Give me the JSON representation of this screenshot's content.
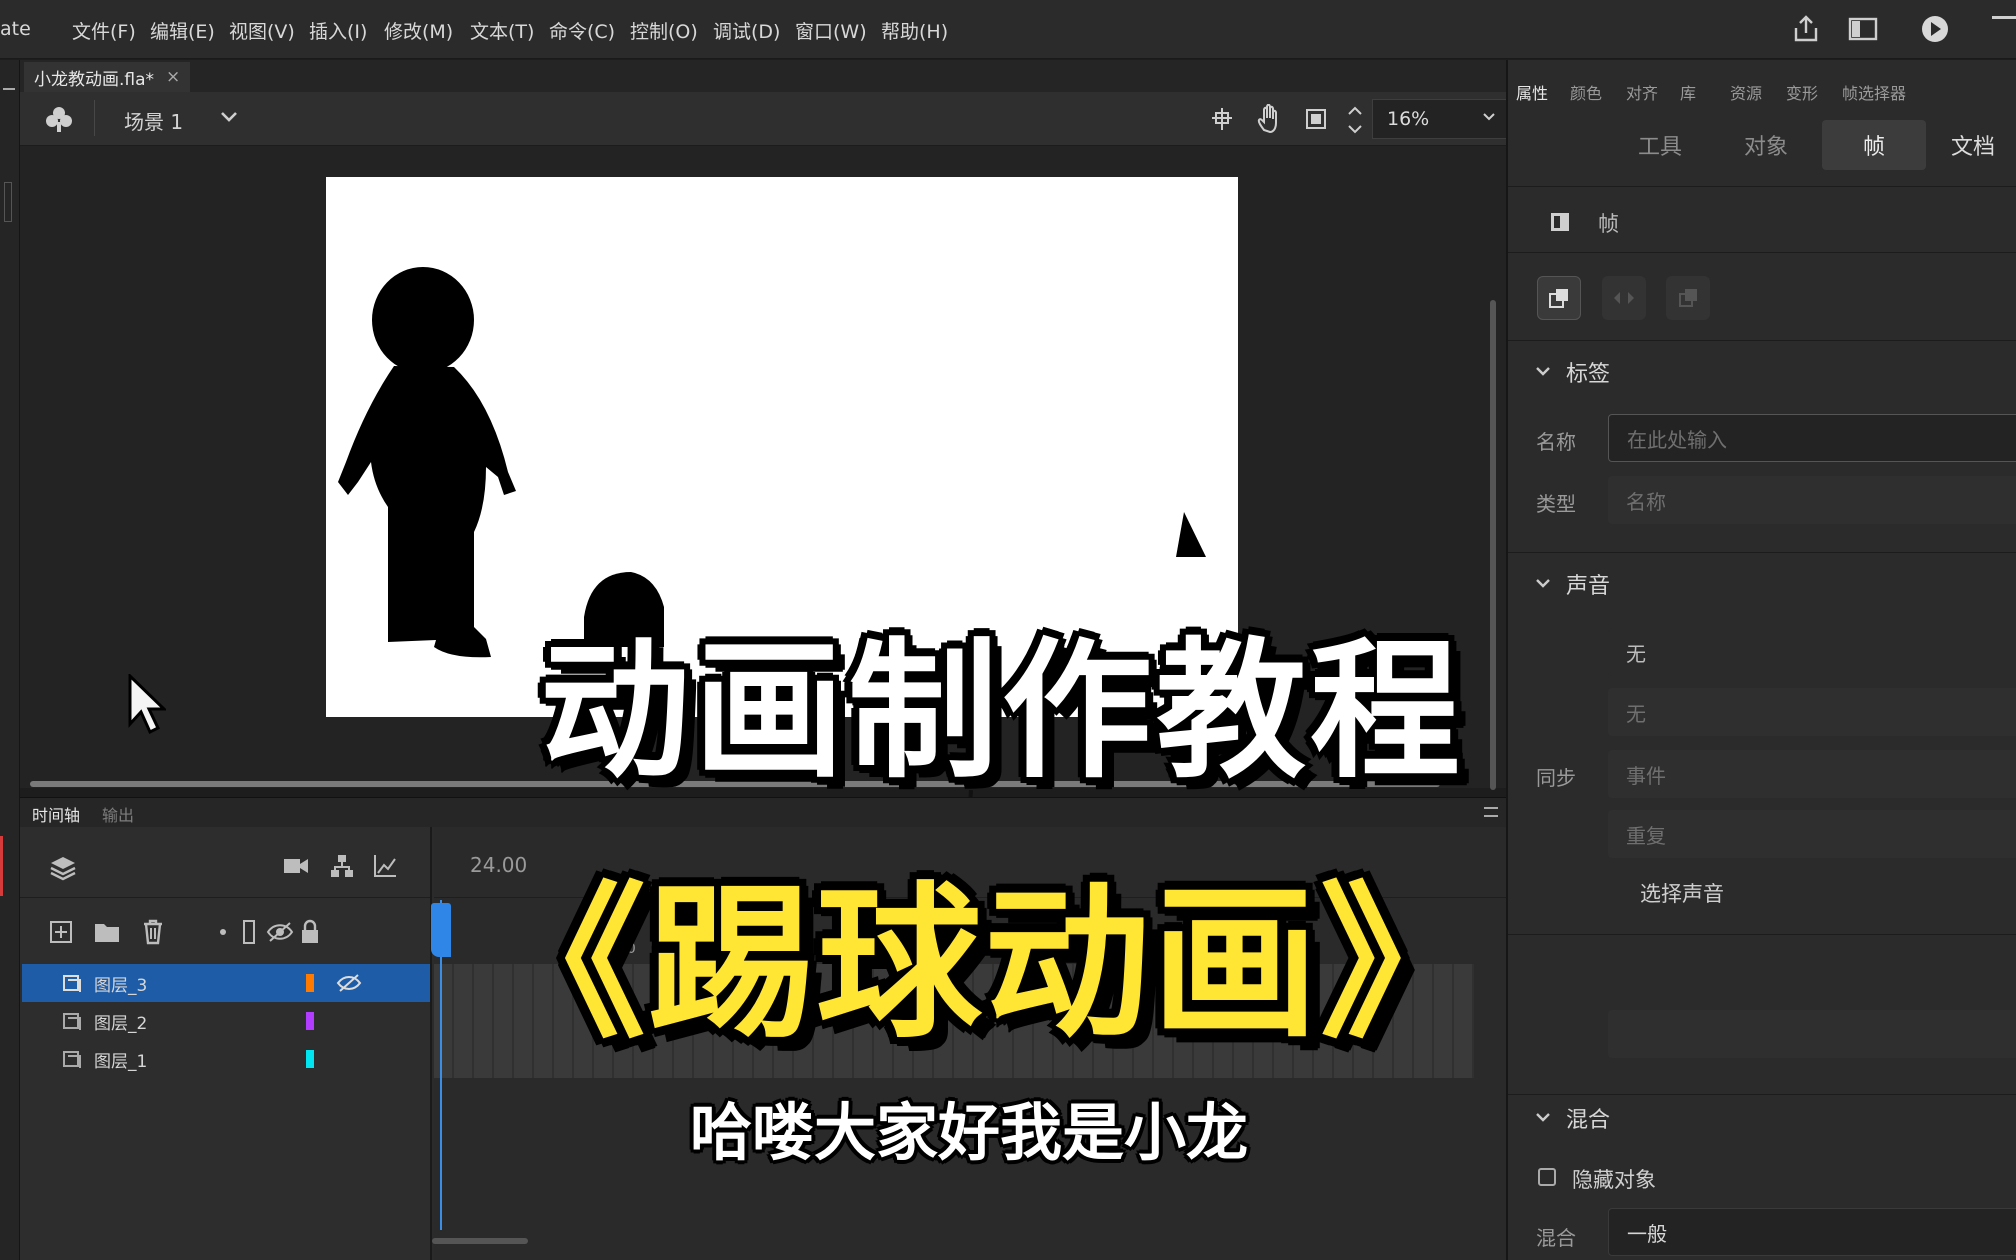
{
  "app": {
    "name_fragment": "ate"
  },
  "menu": [
    "文件(F)",
    "编辑(E)",
    "视图(V)",
    "插入(I)",
    "修改(M)",
    "文本(T)",
    "命令(C)",
    "控制(O)",
    "调试(D)",
    "窗口(W)",
    "帮助(H)"
  ],
  "document": {
    "tab_label": "小龙教动画.fla*",
    "close_glyph": "×"
  },
  "scene": {
    "label": "场景 1",
    "zoom": "16%"
  },
  "timeline": {
    "tabs": [
      "时间轴",
      "输出"
    ],
    "fps": "24.00",
    "frame_marker": "10",
    "layers": [
      {
        "name": "图层_3",
        "color": "#ff7a00",
        "selected": true
      },
      {
        "name": "图层_2",
        "color": "#b23cff",
        "selected": false
      },
      {
        "name": "图层_1",
        "color": "#00e5f0",
        "selected": false
      }
    ]
  },
  "right_panel": {
    "top_tabs": [
      "属性",
      "颜色",
      "对齐",
      "库",
      "资源",
      "变形",
      "帧选择器"
    ],
    "sub_tabs": [
      "工具",
      "对象",
      "帧",
      "文档"
    ],
    "active_sub_tab": "帧",
    "frame_header": "帧",
    "label_section": {
      "title": "标签",
      "name_label": "名称",
      "name_placeholder": "在此处输入",
      "type_label": "类型",
      "type_value": "名称"
    },
    "sound_section": {
      "title": "声音",
      "name_value": "无",
      "effect_value": "无",
      "sync_label": "同步",
      "sync_value": "事件",
      "repeat_value": "重复",
      "choose_sound": "选择声音"
    },
    "blend_section": {
      "title": "混合",
      "hide_object": "隐藏对象",
      "blend_label": "混合",
      "blend_value": "一般"
    }
  },
  "overlay": {
    "title_line1": "动画制作教程",
    "title_line2": "《踢球动画》",
    "subtitle": "哈喽大家好我是小龙"
  }
}
